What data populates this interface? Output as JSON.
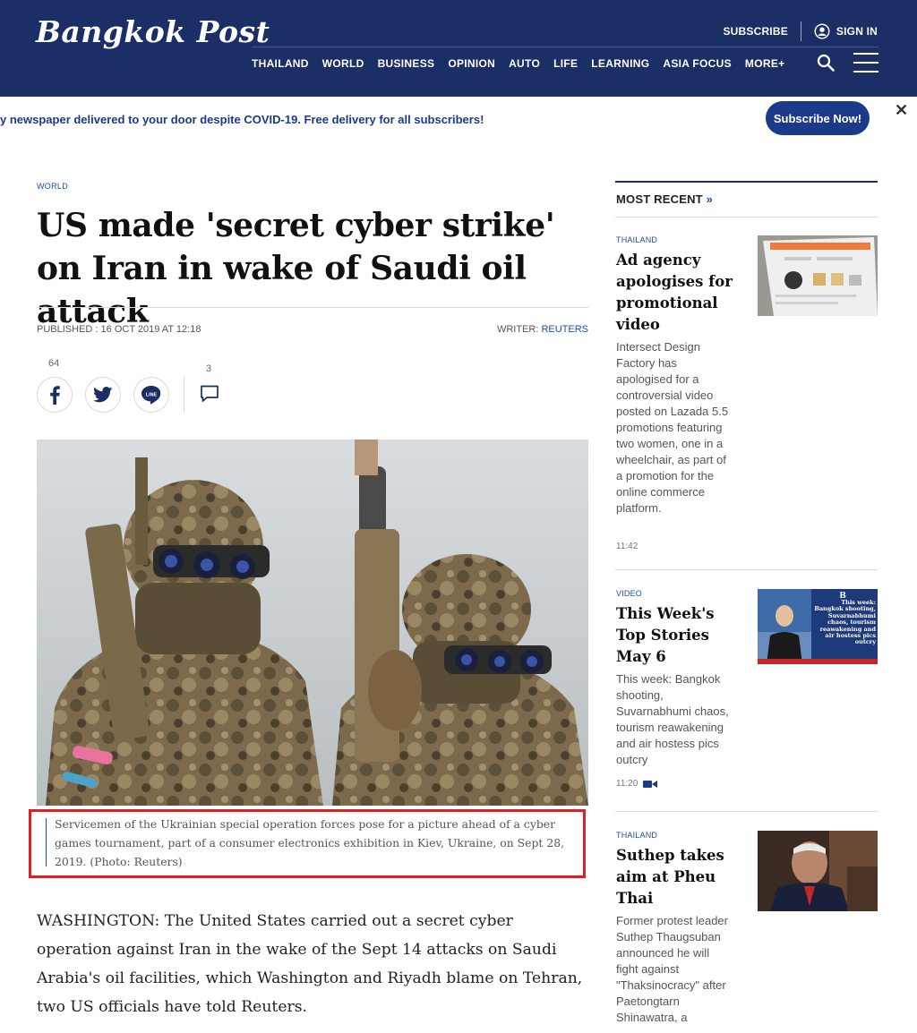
{
  "header": {
    "logo": "Bangkok Post",
    "subscribe": "SUBSCRIBE",
    "sign_in": "SIGN IN",
    "nav": [
      "THAILAND",
      "WORLD",
      "BUSINESS",
      "OPINION",
      "AUTO",
      "LIFE",
      "LEARNING",
      "ASIA FOCUS",
      "MORE+"
    ]
  },
  "promo": {
    "text": "y newspaper delivered to your door despite COVID-19. Free delivery for all subscribers!",
    "button": "Subscribe Now!",
    "close": "✕"
  },
  "article": {
    "section": "WORLD",
    "headline": "US made 'secret cyber strike' on Iran in wake of Saudi oil attack",
    "published": "PUBLISHED : 16 OCT 2019 AT 12:18",
    "writer_label": "WRITER: ",
    "writer_name": "REUTERS",
    "facebook_count": "64",
    "comment_count": "3",
    "line_label": "LINE",
    "caption": "Servicemen of the Ukrainian special operation forces pose for a picture ahead of a cyber games tournament, part of a consumer electronics exhibition in Kiev, Ukraine, on Sept 28, 2019. (Photo: Reuters)",
    "body": "WASHINGTON: The United States carried out a secret cyber operation against Iran in the wake of the Sept 14 attacks on Saudi Arabia's oil facilities, which Washington and Riyadh blame on Tehran, two US officials have told Reuters."
  },
  "sidebar": {
    "heading": "MOST RECENT",
    "heading_chevron": "»",
    "items": [
      {
        "tag": "THAILAND",
        "title": "Ad agency apologises for promotional video",
        "desc": "Intersect Design Factory has apologised for a controversial video posted on Lazada 5.5 promotions featuring two women, one in a wheelchair, as part of a promotion for the online commerce platform.",
        "time": "11:42"
      },
      {
        "tag": "VIDEO",
        "title": "This Week's Top Stories May 6",
        "desc": "This week: Bangkok shooting, Suvarnabhumi chaos, tourism reawakening and air hostess pics outcry",
        "time": "11:20",
        "thumb_text": "This week: Bangkok shooting, Suvarnabhumi chaos, tourism reawakening and air hostess pics outcry"
      },
      {
        "tag": "THAILAND",
        "title": "Suthep takes aim at Pheu Thai",
        "desc": "Former protest leader Suthep Thaugsuban announced he will fight against \"Thaksinocracy\" after Paetongtarn Shinawatra, a"
      }
    ]
  },
  "colors": {
    "brand_navy": "#1b2f66",
    "link_blue": "#1b4fa0",
    "highlight_red": "#e02020"
  }
}
